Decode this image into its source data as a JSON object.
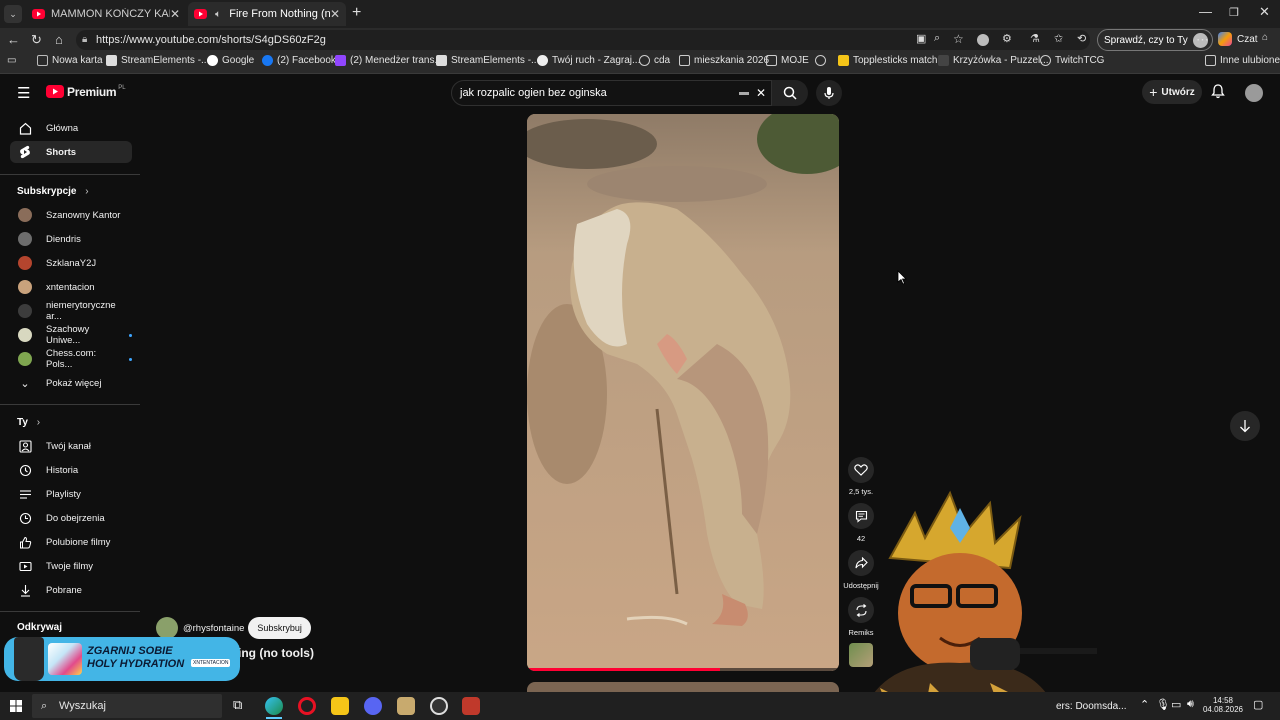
{
  "browser": {
    "tabs": [
      {
        "title": "MAMMON KOŃCZY KARIERĘ!? AI",
        "active": false
      },
      {
        "title": "Fire From Nothing (no tools)",
        "active": true
      }
    ],
    "url": "https://www.youtube.com/shorts/S4gDS60zF2g",
    "profile_button": "Sprawdź, czy to Ty",
    "copilot_label": "Czat",
    "bookmarks": [
      "Nowa karta",
      "StreamElements -...",
      "Google",
      "(2) Facebook",
      "(2) Menedżer trans...",
      "StreamElements -...",
      "Twój ruch - Zagraj...",
      "cda",
      "mieszkania 2026",
      "MOJE",
      "Topplesticks match...",
      "Krzyżówka - Puzzel...",
      "TwitchTCG"
    ],
    "other_favorites": "Inne ulubione"
  },
  "youtube": {
    "logo": "Premium",
    "logo_region": "PL",
    "search_value": "jak rozpalic ogien bez oginska",
    "create_label": "Utwórz",
    "sidebar": {
      "main": [
        {
          "label": "Główna",
          "icon": "home-icon"
        },
        {
          "label": "Shorts",
          "icon": "shorts-icon",
          "active": true
        }
      ],
      "subscriptions_header": "Subskrypcje",
      "subscriptions": [
        {
          "label": "Szanowny Kantor",
          "color": "#8a6d5a"
        },
        {
          "label": "Diendris",
          "color": "#6d6d6d"
        },
        {
          "label": "SzklanaY2J",
          "color": "#b4452e"
        },
        {
          "label": "xntentacion",
          "color": "#c9a27c"
        },
        {
          "label": "niemerytoryczne ar...",
          "color": "#3c3c3c"
        },
        {
          "label": "Szachowy Uniwe...",
          "color": "#d8d8c0",
          "dot": true
        },
        {
          "label": "Chess.com: Pols...",
          "color": "#7fa650",
          "dot": true
        }
      ],
      "show_more": "Pokaż więcej",
      "you_header": "Ty",
      "you_items": [
        {
          "label": "Twój kanał",
          "icon": "account-icon"
        },
        {
          "label": "Historia",
          "icon": "history-icon"
        },
        {
          "label": "Playlisty",
          "icon": "playlist-icon"
        },
        {
          "label": "Do obejrzenia",
          "icon": "clock-icon"
        },
        {
          "label": "Polubione filmy",
          "icon": "thumbs-up-icon"
        },
        {
          "label": "Twoje filmy",
          "icon": "video-icon"
        },
        {
          "label": "Pobrane",
          "icon": "download-icon"
        }
      ],
      "explore_header_partial": "Odkrywaj"
    },
    "short": {
      "channel": "@rhysfontaine",
      "subscribe_label": "Subskrybuj",
      "title_visible": "ing (no tools)",
      "likes": "2,5 tys.",
      "comments": "42",
      "share": "Udostępnij",
      "remix": "Remiks"
    },
    "ad": {
      "headline_line1": "ZGARNIJ SOBIE",
      "headline_line2": "HOLY HYDRATION",
      "tag": "XNTENTACION"
    }
  },
  "taskbar": {
    "search_placeholder": "Wyszukaj",
    "media_text": "ers: Doomsda...",
    "time": "14:58",
    "date": "04.08.2026"
  }
}
